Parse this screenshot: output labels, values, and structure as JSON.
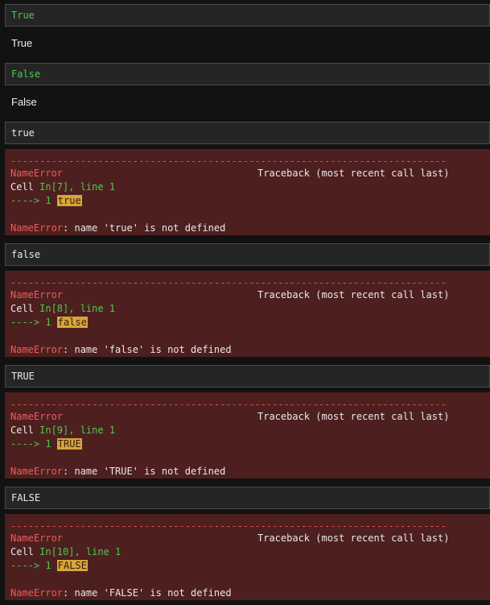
{
  "cells": [
    {
      "input": "True",
      "input_highlight": true,
      "output": "True"
    },
    {
      "input": "False",
      "input_highlight": true,
      "output": "False"
    },
    {
      "input": "true",
      "input_highlight": false,
      "error": {
        "dashes": "---------------------------------------------------------------------------",
        "name": "NameError",
        "traceback": "Traceback (most recent call last)",
        "cell_prefix": "Cell ",
        "cell_ref": "In[7], line 1",
        "arrow": "----> 1 ",
        "code": "true",
        "message": ": name 'true' is not defined"
      }
    },
    {
      "input": "false",
      "input_highlight": false,
      "error": {
        "dashes": "---------------------------------------------------------------------------",
        "name": "NameError",
        "traceback": "Traceback (most recent call last)",
        "cell_prefix": "Cell ",
        "cell_ref": "In[8], line 1",
        "arrow": "----> 1 ",
        "code": "false",
        "message": ": name 'false' is not defined"
      }
    },
    {
      "input": "TRUE",
      "input_highlight": false,
      "error": {
        "dashes": "---------------------------------------------------------------------------",
        "name": "NameError",
        "traceback": "Traceback (most recent call last)",
        "cell_prefix": "Cell ",
        "cell_ref": "In[9], line 1",
        "arrow": "----> 1 ",
        "code": "TRUE",
        "message": ": name 'TRUE' is not defined"
      }
    },
    {
      "input": "FALSE",
      "input_highlight": false,
      "error": {
        "dashes": "---------------------------------------------------------------------------",
        "name": "NameError",
        "traceback": "Traceback (most recent call last)",
        "cell_prefix": "Cell ",
        "cell_ref": "In[10], line 1",
        "arrow": "----> 1 ",
        "code": "FALSE",
        "message": ": name 'FALSE' is not defined"
      }
    }
  ],
  "colors": {
    "background": "#121212",
    "input_bg": "#252526",
    "error_bg": "#4e1f1f",
    "keyword": "#4ec94e",
    "error_name": "#f05a5a",
    "highlight": "#d7a63a"
  }
}
